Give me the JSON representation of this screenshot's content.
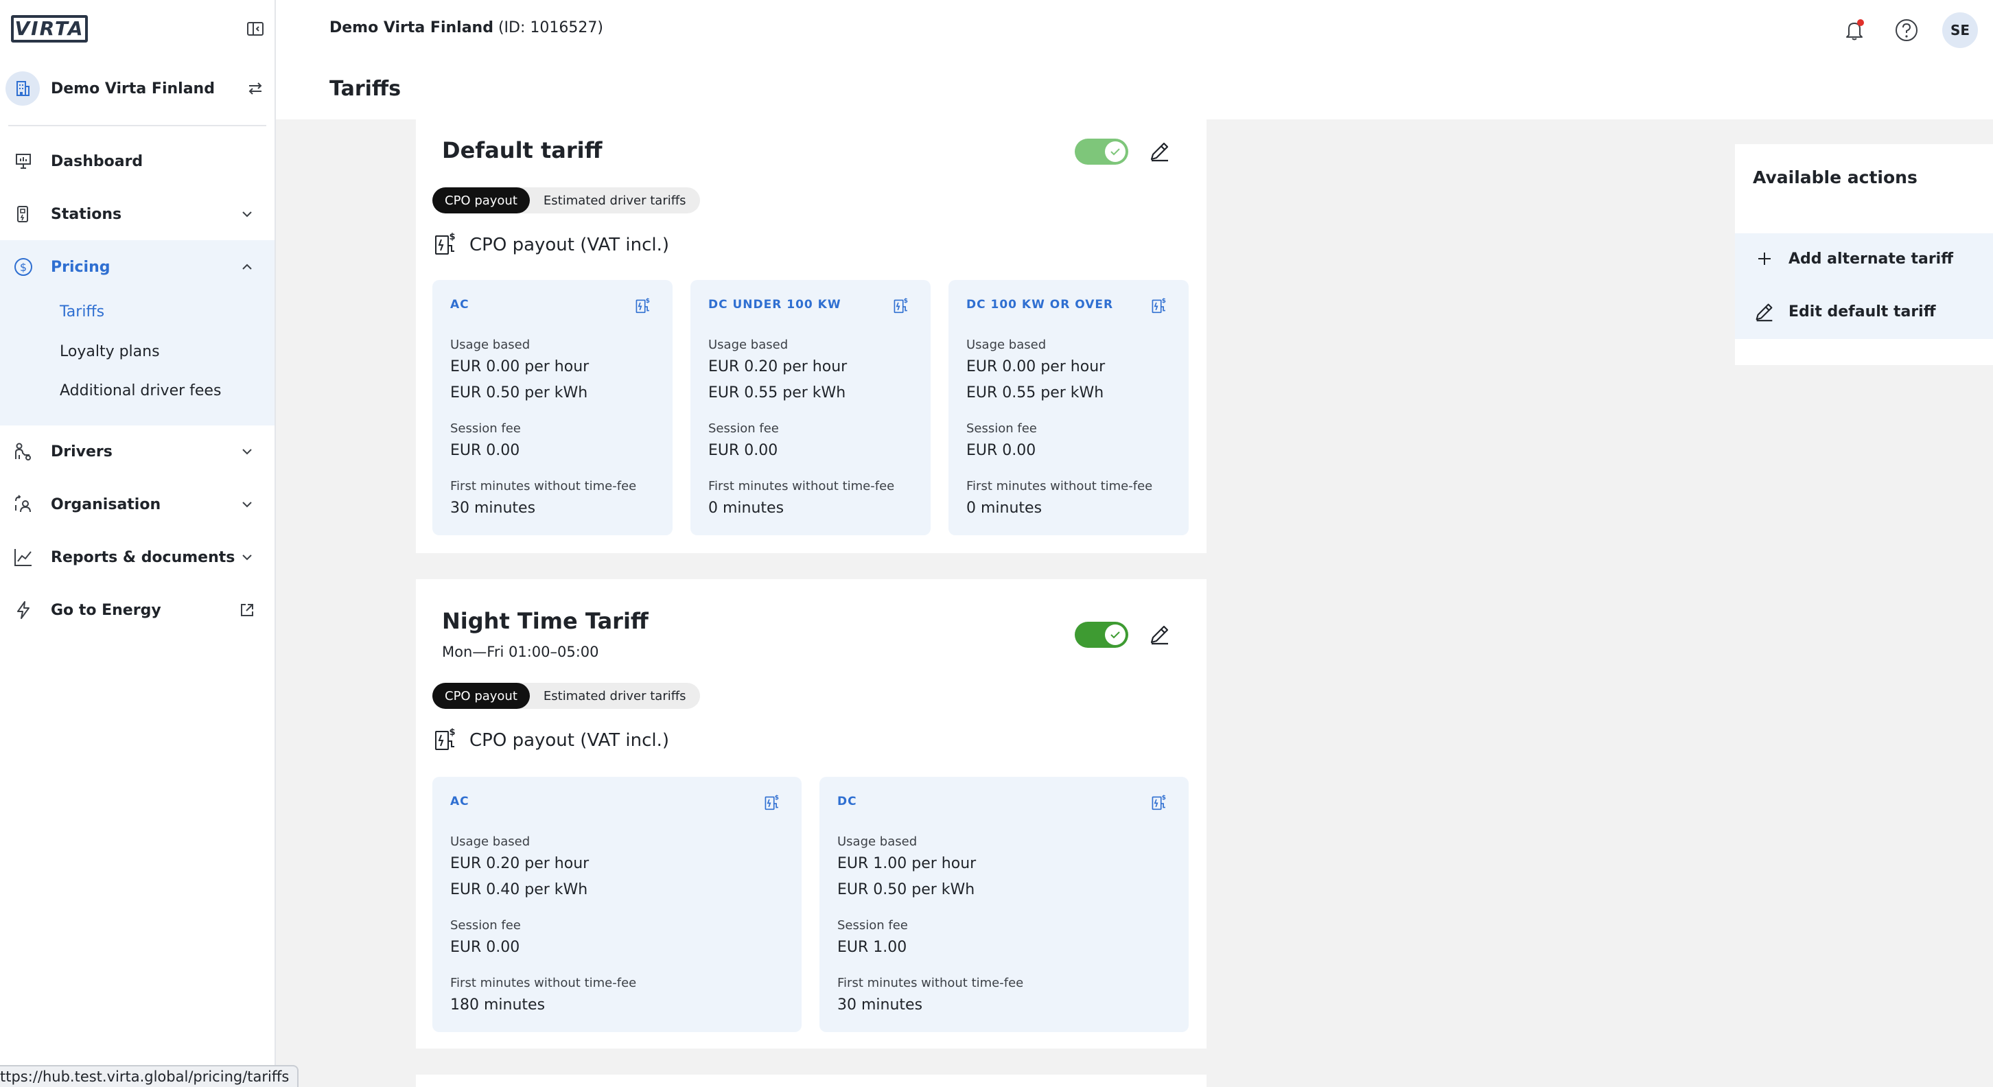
{
  "brand": {
    "logo_text": "VIRTA"
  },
  "org": {
    "name": "Demo Virta Finland",
    "id_text": "(ID: 1016527)"
  },
  "header": {
    "page_title": "Tariffs",
    "user_initials": "SE"
  },
  "sidebar": {
    "items": [
      {
        "label": "Dashboard"
      },
      {
        "label": "Stations"
      },
      {
        "label": "Pricing"
      },
      {
        "label": "Drivers"
      },
      {
        "label": "Organisation"
      },
      {
        "label": "Reports & documents"
      },
      {
        "label": "Go to Energy"
      }
    ],
    "pricing_sub": [
      {
        "label": "Tariffs"
      },
      {
        "label": "Loyalty plans"
      },
      {
        "label": "Additional driver fees"
      }
    ]
  },
  "labels": {
    "cpo_payout_tab": "CPO payout",
    "driver_tab": "Estimated driver tariffs",
    "section_title": "CPO payout (VAT incl.)",
    "usage_based": "Usage based",
    "session_fee": "Session fee",
    "first_minutes": "First minutes without time-fee"
  },
  "tariffs": [
    {
      "title": "Default tariff",
      "schedule": "",
      "boxes": [
        {
          "title": "AC",
          "per_hour": "EUR 0.00 per hour",
          "per_kwh": "EUR 0.50 per kWh",
          "session_fee": "EUR 0.00",
          "free_minutes": "30 minutes"
        },
        {
          "title": "DC UNDER 100 KW",
          "per_hour": "EUR 0.20 per hour",
          "per_kwh": "EUR 0.55 per kWh",
          "session_fee": "EUR 0.00",
          "free_minutes": "0 minutes"
        },
        {
          "title": "DC 100 KW OR OVER",
          "per_hour": "EUR 0.00 per hour",
          "per_kwh": "EUR 0.55 per kWh",
          "session_fee": "EUR 0.00",
          "free_minutes": "0 minutes"
        }
      ]
    },
    {
      "title": "Night Time Tariff",
      "schedule": "Mon—Fri 01:00–05:00",
      "boxes": [
        {
          "title": "AC",
          "per_hour": "EUR 0.20 per hour",
          "per_kwh": "EUR 0.40 per kWh",
          "session_fee": "EUR 0.00",
          "free_minutes": "180 minutes"
        },
        {
          "title": "DC",
          "per_hour": "EUR 1.00 per hour",
          "per_kwh": "EUR 0.50 per kWh",
          "session_fee": "EUR 1.00",
          "free_minutes": "30 minutes"
        }
      ]
    }
  ],
  "actions": {
    "title": "Available actions",
    "items": [
      {
        "label": "Add alternate tariff",
        "icon": "plus-icon"
      },
      {
        "label": "Edit default tariff",
        "icon": "pencil-icon"
      }
    ]
  },
  "status_url": "ttps://hub.test.virta.global/pricing/tariffs"
}
